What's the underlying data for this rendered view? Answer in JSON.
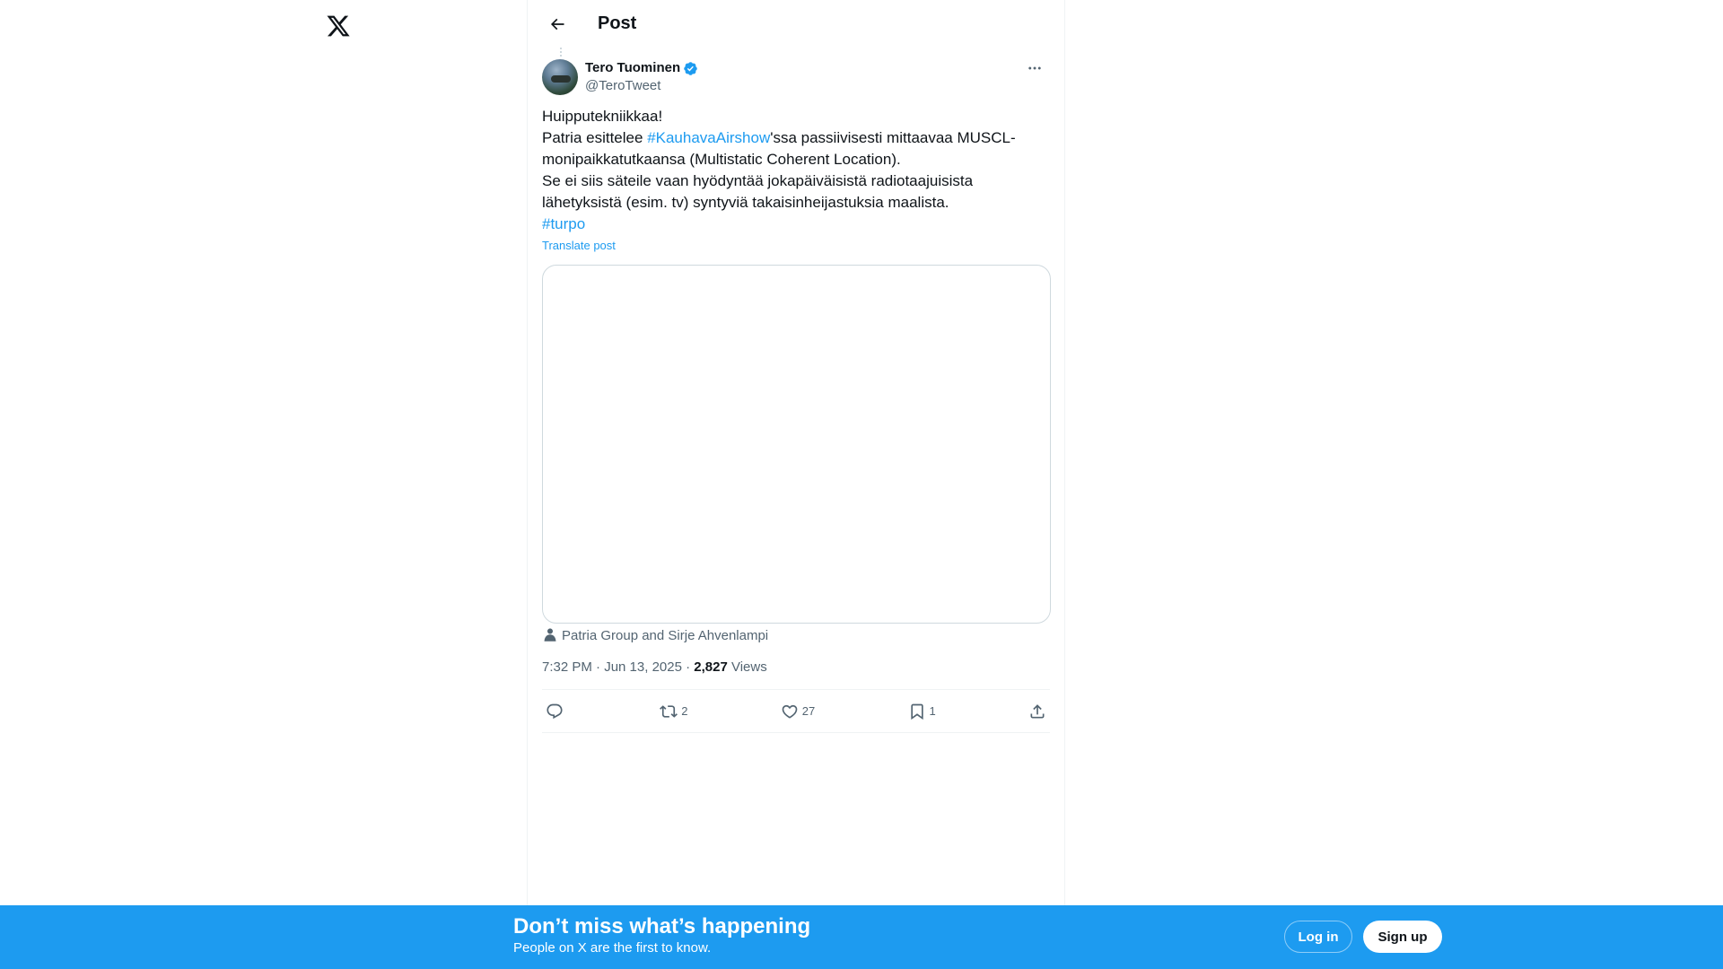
{
  "header": {
    "title": "Post"
  },
  "post": {
    "author": {
      "name": "Tero Tuominen",
      "handle": "@TeroTweet",
      "verified": true
    },
    "text": {
      "line1": "Huipputekniikkaa!",
      "line2_prefix": "Patria esittelee ",
      "hashtag1": "#KauhavaAirshow",
      "line2_suffix": "'ssa passiivisesti mittaavaa MUSCL-monipaikkatutkaansa (Multistatic Coherent Location).",
      "line3": "Se ei siis säteile vaan hyödyntää jokapäiväisistä radiotaajuisista lähetyksistä (esim. tv) syntyviä takaisinheijastuksia maalista.",
      "hashtag2": "#turpo"
    },
    "translate_label": "Translate post",
    "tagged": "Patria Group and Sirje Ahvenlampi",
    "time": "7:32 PM · Jun 13, 2025 · ",
    "views_count": "2,827",
    "views_label": " Views",
    "actions": {
      "reply": "",
      "repost": "2",
      "like": "27",
      "bookmark": "1"
    }
  },
  "banner": {
    "title": "Don’t miss what’s happening",
    "subtitle": "People on X are the first to know.",
    "login": "Log in",
    "signup": "Sign up"
  },
  "colors": {
    "accent": "#1d9bf0",
    "text": "#0f1419",
    "muted": "#536471"
  },
  "icons": [
    "x-logo-icon",
    "back-arrow-icon",
    "verified-icon",
    "more-icon",
    "person-icon",
    "reply-icon",
    "repost-icon",
    "like-icon",
    "bookmark-icon",
    "share-icon"
  ]
}
